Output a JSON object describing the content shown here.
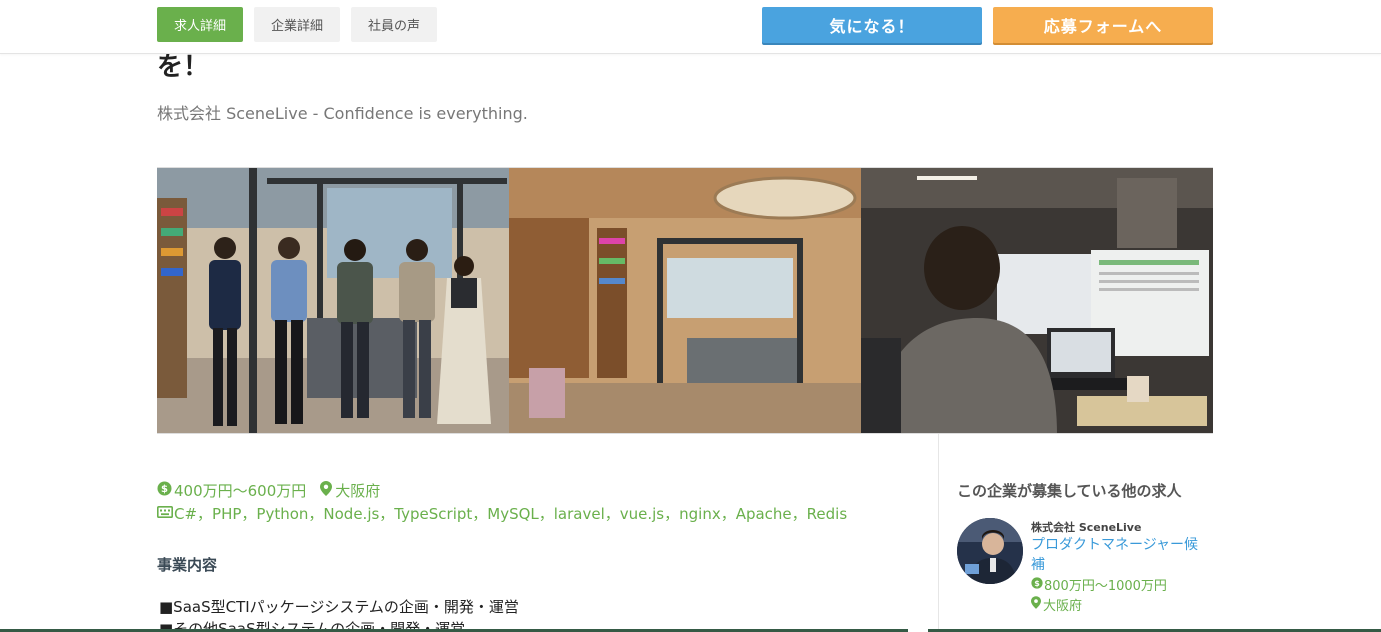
{
  "nav": {
    "tabs": [
      {
        "label": "求人詳細",
        "active": true
      },
      {
        "label": "企業詳細",
        "active": false
      },
      {
        "label": "社員の声",
        "active": false
      }
    ],
    "interest_button": "気になる！",
    "apply_button": "応募フォームへ"
  },
  "job": {
    "title_fragment": "を！",
    "company_tagline": "株式会社 SceneLive - Confidence is everything.",
    "hero_alt": "office-photo",
    "salary": "400万円〜600万円",
    "location": "大阪府",
    "skills": "C#，PHP，Python，Node.js，TypeScript，MySQL，laravel，vue.js，nginx，Apache，Redis",
    "section_title": "事業内容",
    "bullets": [
      "■SaaS型CTIパッケージシステムの企画・開発・運営",
      "■その他SaaS型システムの企画・開発・運営"
    ]
  },
  "sidebar": {
    "heading": "この企業が募集している他の求人",
    "listing": {
      "company": "株式会社 SceneLive",
      "title": "プロダクトマネージャー候補",
      "salary": "800万円〜1000万円",
      "location": "大阪府"
    }
  },
  "colors": {
    "green": "#6ab04c",
    "blue": "#4aa3df",
    "orange": "#f6ad4f",
    "link": "#3a9ad9"
  },
  "icons": [
    "yen-circle-icon",
    "map-pin-icon",
    "keyboard-icon"
  ]
}
